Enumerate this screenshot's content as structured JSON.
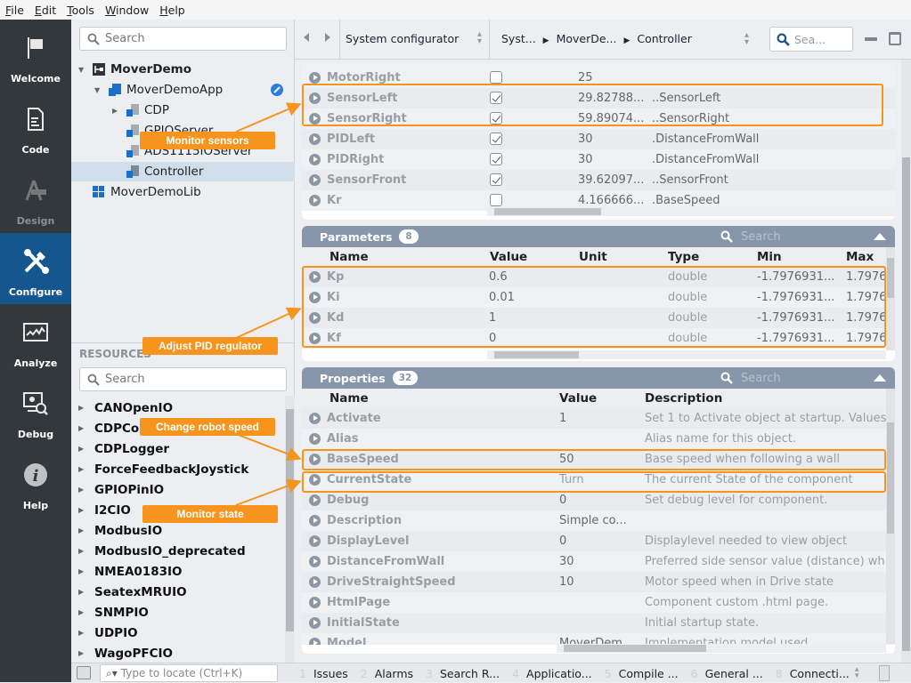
{
  "menu": [
    "File",
    "Edit",
    "Tools",
    "Window",
    "Help"
  ],
  "nav": [
    {
      "label": "Welcome",
      "icon": "flag-icon",
      "state": "normal"
    },
    {
      "label": "Code",
      "icon": "document-icon",
      "state": "normal"
    },
    {
      "label": "Design",
      "icon": "design-tools-icon",
      "state": "disabled"
    },
    {
      "label": "Configure",
      "icon": "wrench-screwdriver-icon",
      "state": "active"
    },
    {
      "label": "Analyze",
      "icon": "chart-monitor-icon",
      "state": "normal"
    },
    {
      "label": "Debug",
      "icon": "debug-monitor-icon",
      "state": "normal"
    },
    {
      "label": "Help",
      "icon": "info-icon",
      "state": "normal"
    }
  ],
  "tree": {
    "search_placeholder": "Search",
    "nodes": [
      {
        "label": "MoverDemo",
        "bold": true,
        "expanded": true,
        "level": 0
      },
      {
        "label": "MoverDemoApp",
        "expanded": true,
        "level": 1,
        "badge": "link-icon"
      },
      {
        "label": "CDP",
        "expandable": true,
        "level": 2
      },
      {
        "label": "GPIOServer",
        "level": 2
      },
      {
        "label": "ADS1115IOServer",
        "level": 2
      },
      {
        "label": "Controller",
        "level": 2,
        "selected": true
      },
      {
        "label": "MoverDemoLib",
        "level": 0
      }
    ]
  },
  "resources": {
    "header": "RESOURCES",
    "search_placeholder": "Search",
    "items": [
      "CANOpenIO",
      "CDPCore",
      "CDPLogger",
      "ForceFeedbackJoystick",
      "GPIOPinIO",
      "I2CIO",
      "ModbusIO",
      "ModbusIO_deprecated",
      "NMEA0183IO",
      "SeatexMRUIO",
      "SNMPIO",
      "UDPIO",
      "WagoPFCIO"
    ]
  },
  "topbar": {
    "view_selector": "System configurator",
    "breadcrumb": [
      "Syst...",
      "MoverDe...",
      "Controller"
    ],
    "search_placeholder": "Sea..."
  },
  "signals": {
    "rows": [
      {
        "name": "MotorRight",
        "checked": false,
        "value": "25",
        "routing": ""
      },
      {
        "name": "SensorLeft",
        "checked": true,
        "value": "29.82788...",
        "routing": "..SensorLeft"
      },
      {
        "name": "SensorRight",
        "checked": true,
        "value": "59.89074...",
        "routing": "..SensorRight"
      },
      {
        "name": "PIDLeft",
        "checked": true,
        "value": "30",
        "routing": ".DistanceFromWall"
      },
      {
        "name": "PIDRight",
        "checked": true,
        "value": "30",
        "routing": ".DistanceFromWall"
      },
      {
        "name": "SensorFront",
        "checked": true,
        "value": "39.62097...",
        "routing": "..SensorFront"
      },
      {
        "name": "Kr",
        "checked": false,
        "value": "4.166666...",
        "routing": ".BaseSpeed"
      }
    ]
  },
  "parameters": {
    "title": "Parameters",
    "count": "8",
    "search_placeholder": "Search",
    "columns": [
      "Name",
      "Value",
      "Unit",
      "Type",
      "Min",
      "Max"
    ],
    "rows": [
      {
        "name": "Kp",
        "value": "0.6",
        "unit": "",
        "type": "double",
        "min": "-1.7976931...",
        "max": "1.7976"
      },
      {
        "name": "Ki",
        "value": "0.01",
        "unit": "",
        "type": "double",
        "min": "-1.7976931...",
        "max": "1.7976"
      },
      {
        "name": "Kd",
        "value": "1",
        "unit": "",
        "type": "double",
        "min": "-1.7976931...",
        "max": "1.7976"
      },
      {
        "name": "Kf",
        "value": "0",
        "unit": "",
        "type": "double",
        "min": "-1.7976931...",
        "max": "1.7976"
      }
    ]
  },
  "properties": {
    "title": "Properties",
    "count": "32",
    "search_placeholder": "Search",
    "columns": [
      "Name",
      "Value",
      "Description"
    ],
    "rows": [
      {
        "name": "Activate",
        "value": "1",
        "desc": "Set 1 to Activate object at startup. Values"
      },
      {
        "name": "Alias",
        "value": "",
        "desc": "Alias name for this object."
      },
      {
        "name": "BaseSpeed",
        "value": "50",
        "desc": "Base speed when following a wall"
      },
      {
        "name": "CurrentState",
        "value": "Turn",
        "desc": "The current State of the component"
      },
      {
        "name": "Debug",
        "value": "0",
        "desc": "Set debug level for component."
      },
      {
        "name": "Description",
        "value": "Simple co...",
        "desc": ""
      },
      {
        "name": "DisplayLevel",
        "value": "0",
        "desc": "Displaylevel needed to view object"
      },
      {
        "name": "DistanceFromWall",
        "value": "30",
        "desc": "Preferred side sensor value (distance) wh"
      },
      {
        "name": "DriveStraightSpeed",
        "value": "10",
        "desc": "Motor speed when in Drive state"
      },
      {
        "name": "HtmlPage",
        "value": "",
        "desc": "Component custom .html page."
      },
      {
        "name": "InitialState",
        "value": "",
        "desc": "Initial startup state."
      },
      {
        "name": "Model",
        "value": "MoverDem...",
        "desc": "Implementation model used"
      }
    ]
  },
  "callouts": {
    "sensors": "Monitor sensors",
    "pid": "Adjust PID regulator",
    "speed": "Change robot speed",
    "state": "Monitor state"
  },
  "bottom": {
    "locate_placeholder": "Type to locate (Ctrl+K)",
    "tabs": [
      {
        "n": "1",
        "label": "Issues"
      },
      {
        "n": "2",
        "label": "Alarms"
      },
      {
        "n": "3",
        "label": "Search R..."
      },
      {
        "n": "4",
        "label": "Applicatio..."
      },
      {
        "n": "5",
        "label": "Compile ..."
      },
      {
        "n": "6",
        "label": "General ..."
      },
      {
        "n": "8",
        "label": "Connecti..."
      }
    ]
  },
  "colors": {
    "accent": "#f7941d",
    "nav_active": "#16568f",
    "panel_header": "#8896ab"
  }
}
